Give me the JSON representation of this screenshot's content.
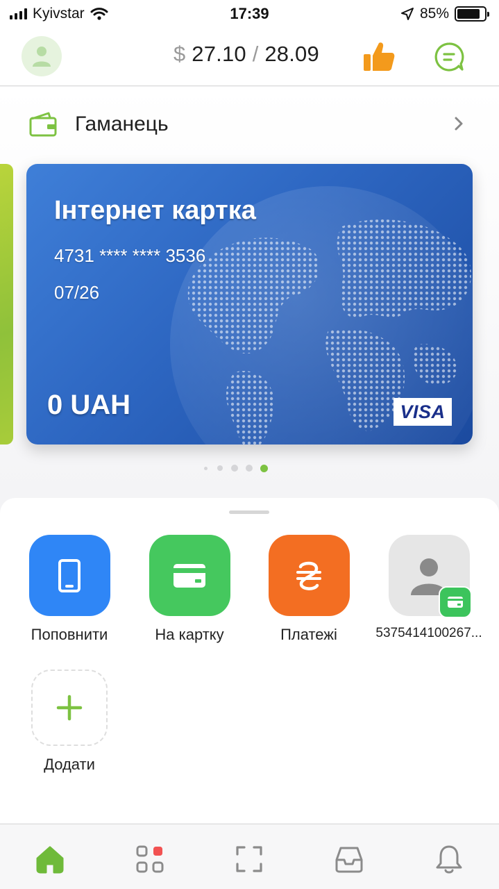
{
  "status_bar": {
    "carrier": "Kyivstar",
    "time": "17:39",
    "battery": "85%",
    "battery_level": 0.85
  },
  "header": {
    "currency_symbol": "$",
    "rate_buy": "27.10",
    "separator": "/",
    "rate_sell": "28.09"
  },
  "wallet": {
    "title": "Гаманець"
  },
  "card": {
    "name": "Інтернет картка",
    "number": "4731 **** **** 3536",
    "expiry": "07/26",
    "balance": "0 UAH",
    "network": "VISA"
  },
  "pager": {
    "count": 5,
    "active_index": 4
  },
  "actions": [
    {
      "label": "Поповнити",
      "icon": "phone-icon",
      "color": "#2f86f6"
    },
    {
      "label": "На картку",
      "icon": "card-icon",
      "color": "#45c85e"
    },
    {
      "label": "Платежі",
      "icon": "hryvnia-icon",
      "color": "#f36e22"
    },
    {
      "label": "5375414100267...",
      "icon": "contact-icon",
      "color": "#e6e6e6"
    },
    {
      "label": "Додати",
      "icon": "plus-icon",
      "color": "#7dc242"
    }
  ],
  "colors": {
    "accent_green": "#7dc242",
    "like_orange": "#f39a1c",
    "card_blue": "#2d66c1",
    "notification_red": "#f25252"
  }
}
